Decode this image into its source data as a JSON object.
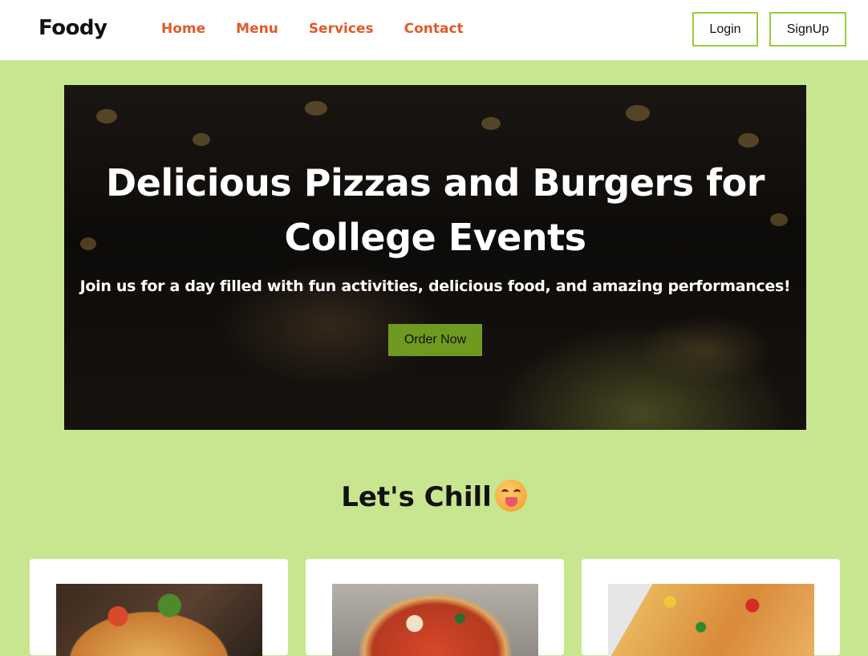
{
  "navbar": {
    "brand": "Foody",
    "links": [
      "Home",
      "Menu",
      "Services",
      "Contact"
    ],
    "login_label": "Login",
    "signup_label": "SignUp",
    "link_color": "#e05a2b",
    "button_border_color": "#9ccc3c"
  },
  "hero": {
    "title_line1": "Delicious Pizzas and Burgers for",
    "title_line2": "College Events",
    "subtitle": "Join us for a day filled with fun activities, delicious food, and amazing performances!",
    "cta_label": "Order Now",
    "cta_color": "#6f9a1f"
  },
  "section": {
    "title": "Let's Chill",
    "emoji_icon": "yum-face-icon"
  },
  "cards": [
    {
      "image": "pizza-with-vegetables-image"
    },
    {
      "image": "margherita-pizza-image"
    },
    {
      "image": "veggie-pizza-slices-image"
    }
  ],
  "colors": {
    "page_background": "#c8e690"
  }
}
